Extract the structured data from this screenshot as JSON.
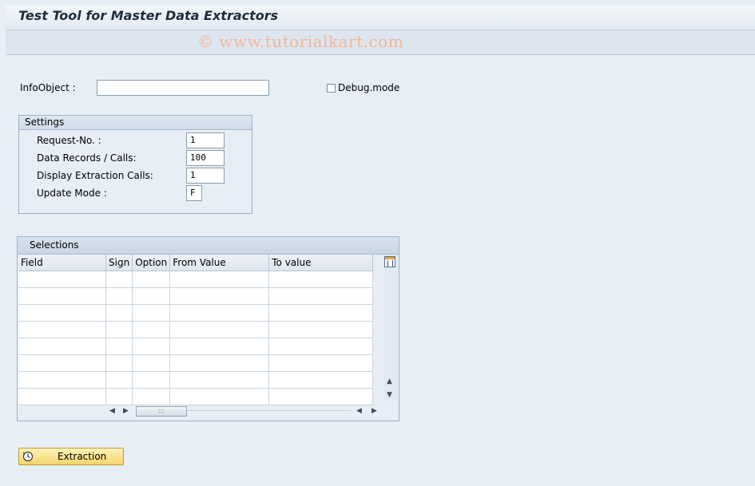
{
  "window": {
    "title": "Test Tool for Master Data Extractors",
    "watermark": "© www.tutorialkart.com"
  },
  "form": {
    "infoobject_label": "InfoObject :",
    "infoobject_value": "",
    "debug_label": "Debug.mode",
    "debug_checked": false
  },
  "settings": {
    "title": "Settings",
    "fields": [
      {
        "label": "Request-No. :",
        "value": "1"
      },
      {
        "label": "Data Records / Calls:",
        "value": "100"
      },
      {
        "label": "Display Extraction Calls:",
        "value": "1"
      },
      {
        "label": "Update Mode :",
        "value": "F"
      }
    ]
  },
  "selections": {
    "title": "Selections",
    "columns": [
      "Field",
      "Sign",
      "Option",
      "From Value",
      "To value"
    ],
    "rows": [
      [
        "",
        "",
        "",
        "",
        ""
      ],
      [
        "",
        "",
        "",
        "",
        ""
      ],
      [
        "",
        "",
        "",
        "",
        ""
      ],
      [
        "",
        "",
        "",
        "",
        ""
      ],
      [
        "",
        "",
        "",
        "",
        ""
      ],
      [
        "",
        "",
        "",
        "",
        ""
      ],
      [
        "",
        "",
        "",
        "",
        ""
      ],
      [
        "",
        "",
        "",
        "",
        ""
      ]
    ]
  },
  "actions": {
    "extraction_label": "Extraction"
  },
  "colors": {
    "background": "#e8eef5",
    "button_accent": "#f4d56b"
  }
}
